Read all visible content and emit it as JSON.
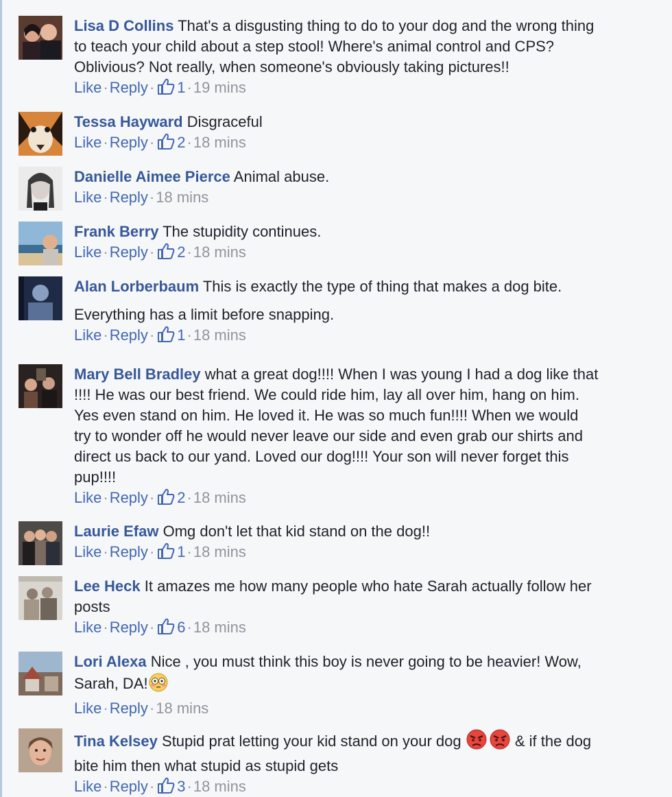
{
  "actions": {
    "like": "Like",
    "reply": "Reply",
    "separator": "·"
  },
  "colors": {
    "author": "#365899",
    "link": "#4267b2",
    "meta": "#90949c",
    "text": "#1d2129",
    "background": "#f6f7f9"
  },
  "comments": [
    {
      "author": "Lisa D Collins",
      "text": "That's a disgusting thing to do to your dog and the wrong thing\nto teach your child about a step stool! Where's animal control and CPS?\nOblivious? Not really, when someone's obviously taking pictures!!",
      "likes": "1",
      "time": "19 mins"
    },
    {
      "author": "Tessa Hayward",
      "text": "Disgraceful",
      "likes": "2",
      "time": "18 mins"
    },
    {
      "author": "Danielle Aimee Pierce",
      "text": "Animal abuse.",
      "likes": "",
      "time": "18 mins"
    },
    {
      "author": "Frank Berry",
      "text": "The stupidity continues.",
      "likes": "2",
      "time": "18 mins"
    },
    {
      "author": "Alan Lorberbaum",
      "text": "This is exactly the type of thing that makes a dog bite.",
      "extra": "Everything has a limit before snapping.",
      "likes": "1",
      "time": "18 mins"
    },
    {
      "author": "Mary Bell Bradley",
      "text": "what a great dog!!!! When I was young I had a dog like that\n!!!! He was our best friend. We could ride him, lay all over him, hang on him.\nYes even stand on him. He loved it. He was so much fun!!!! When we would\ntry to wonder off he would never leave our side and even grab our shirts and\ndirect us back to our yand. Loved our dog!!!! Your son will never forget this\npup!!!!",
      "likes": "2",
      "time": "18 mins"
    },
    {
      "author": "Laurie Efaw",
      "text": "Omg don't let that kid stand on the dog!!",
      "likes": "1",
      "time": "18 mins"
    },
    {
      "author": "Lee Heck",
      "text": "It amazes me how many people who hate Sarah actually follow her\nposts",
      "likes": "6",
      "time": "18 mins"
    },
    {
      "author": "Lori Alexa",
      "text": "Nice , you must think this boy is never going to be heavier! Wow,\nSarah, DA!",
      "emoji": "flushed-face-emoji",
      "likes": "",
      "time": "18 mins"
    },
    {
      "author": "Tina Kelsey",
      "text": "Stupid prat letting your kid stand on your dog",
      "emoji": "angry-face-emoji",
      "text2": " & if the dog\nbite him then what stupid as stupid gets",
      "likes": "3",
      "time": "18 mins"
    }
  ]
}
